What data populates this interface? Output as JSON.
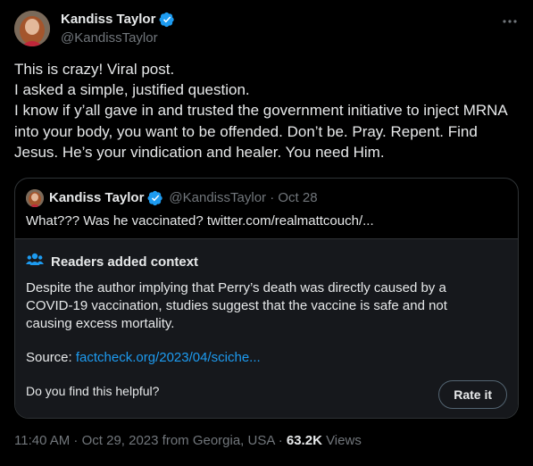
{
  "author": {
    "name": "Kandiss Taylor",
    "handle": "@KandissTaylor"
  },
  "tweet_text": "This is crazy! Viral post.\nI asked a simple, justified question.\nI know if y’all gave in and trusted the government initiative to inject MRNA into your body, you want to be offended. Don’t be. Pray. Repent. Find Jesus. He’s your vindication and healer. You need Him.",
  "quoted": {
    "name": "Kandiss Taylor",
    "meta": "@KandissTaylor · Oct 28",
    "text": "What??? Was he vaccinated? twitter.com/realmattcouch/..."
  },
  "context_note": {
    "title": "Readers added context",
    "body": "Despite the author implying that Perry’s death was directly caused by a COVID-19 vaccination, studies suggest that the vaccine is safe and not causing excess mortality.",
    "source_label": "Source:",
    "source_link": "factcheck.org/2023/04/sciche...",
    "question": "Do you find this helpful?",
    "rate_label": "Rate it"
  },
  "footer": {
    "timestamp": "11:40 AM · Oct 29, 2023 from Georgia, USA ·",
    "views_count": "63.2K",
    "views_label": "Views"
  },
  "colors": {
    "background": "#000000",
    "text": "#e7e9ea",
    "muted": "#71767b",
    "link": "#1d9bf0",
    "verified": "#1d9bf0",
    "border": "#2f3336",
    "note_background": "#16181c"
  },
  "icons": [
    "verified-badge-icon",
    "more-icon",
    "readers-icon"
  ]
}
